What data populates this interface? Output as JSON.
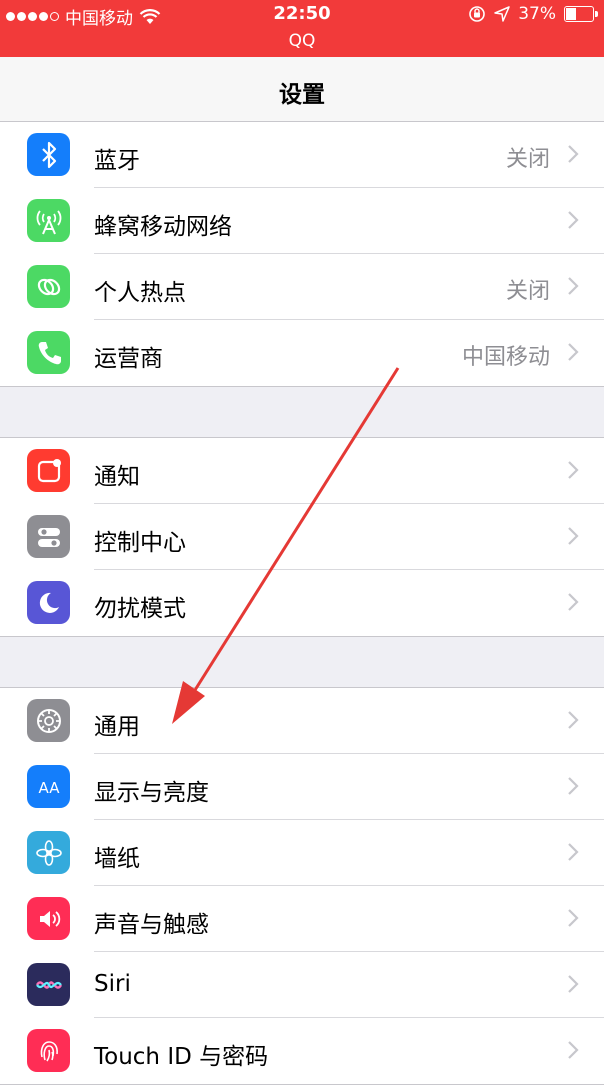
{
  "status_bar": {
    "carrier": "中国移动",
    "time": "22:50",
    "app": "QQ",
    "battery": "37%",
    "battery_level": 0.37
  },
  "nav": {
    "title": "设置"
  },
  "groups": [
    {
      "items": [
        {
          "label": "蓝牙",
          "value": "关闭",
          "icon": "bluetooth-icon",
          "color": "#147efb"
        },
        {
          "label": "蜂窝移动网络",
          "value": "",
          "icon": "cellular-icon",
          "color": "#4cd964"
        },
        {
          "label": "个人热点",
          "value": "关闭",
          "icon": "hotspot-icon",
          "color": "#4cd964"
        },
        {
          "label": "运营商",
          "value": "中国移动",
          "icon": "phone-icon",
          "color": "#4cd964"
        }
      ]
    },
    {
      "items": [
        {
          "label": "通知",
          "value": "",
          "icon": "notifications-icon",
          "color": "#ff3b30"
        },
        {
          "label": "控制中心",
          "value": "",
          "icon": "control-center-icon",
          "color": "#8e8e93"
        },
        {
          "label": "勿扰模式",
          "value": "",
          "icon": "moon-icon",
          "color": "#5856d6"
        }
      ]
    },
    {
      "items": [
        {
          "label": "通用",
          "value": "",
          "icon": "gear-icon",
          "color": "#8e8e93"
        },
        {
          "label": "显示与亮度",
          "value": "",
          "icon": "display-icon",
          "color": "#147efb"
        },
        {
          "label": "墙纸",
          "value": "",
          "icon": "wallpaper-icon",
          "color": "#34aadc"
        },
        {
          "label": "声音与触感",
          "value": "",
          "icon": "speaker-icon",
          "color": "#ff2d55"
        },
        {
          "label": "Siri",
          "value": "",
          "icon": "siri-icon",
          "color": "#2b2b5c"
        },
        {
          "label": "Touch ID 与密码",
          "value": "",
          "icon": "fingerprint-icon",
          "color": "#ff2d55"
        }
      ]
    }
  ]
}
